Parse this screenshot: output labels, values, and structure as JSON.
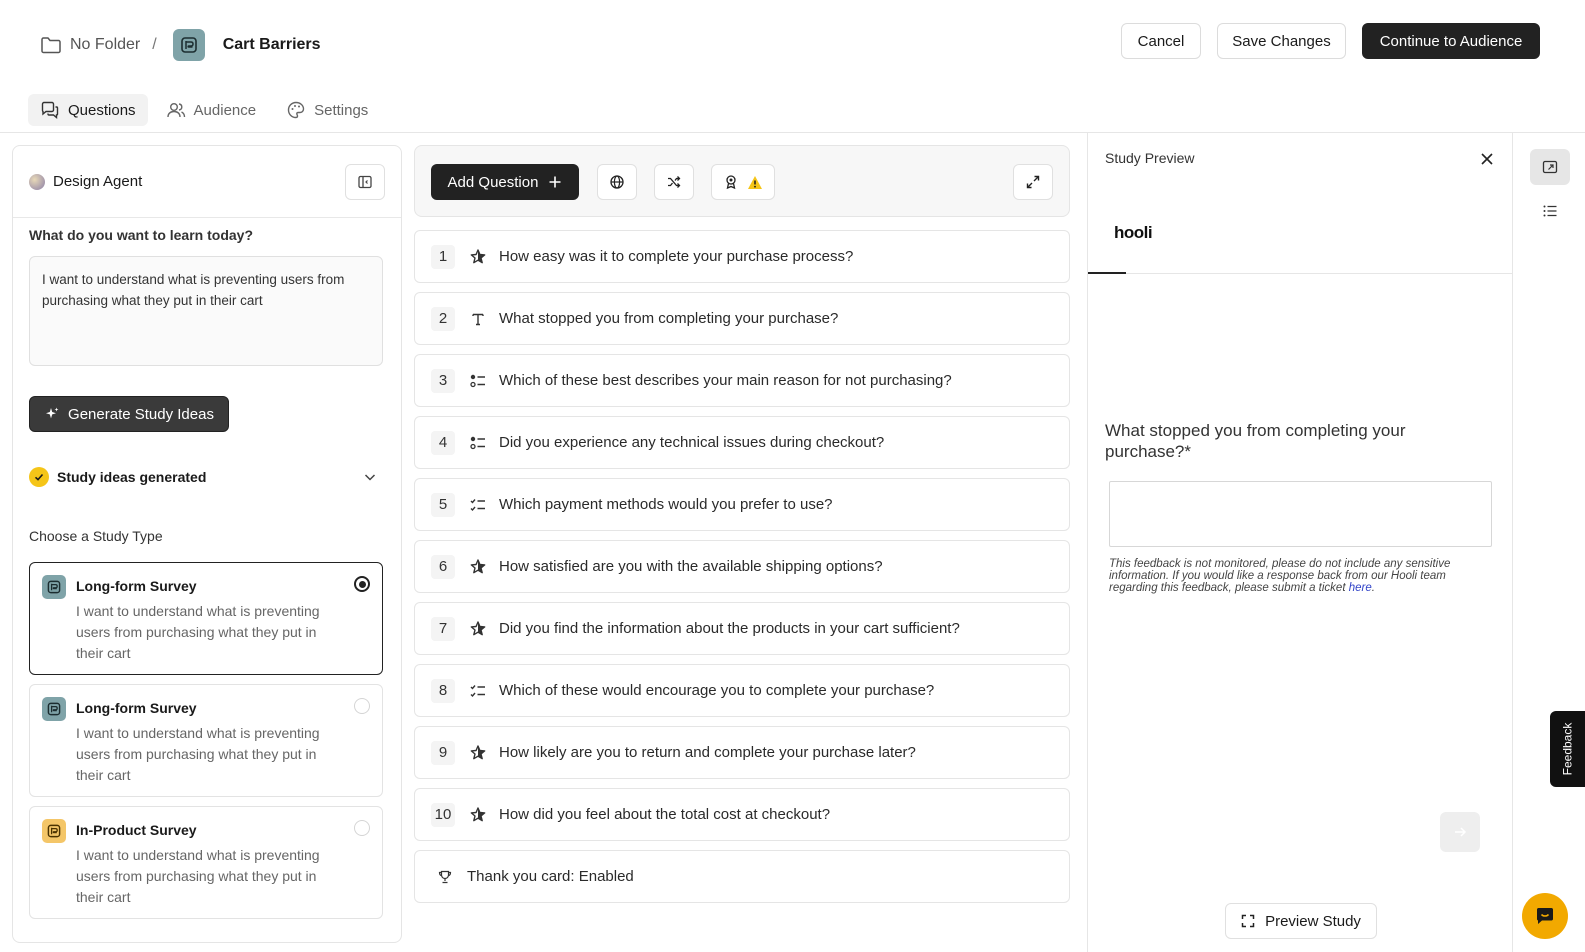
{
  "header": {
    "folder_label": "No Folder",
    "separator": "/",
    "study_title": "Cart Barriers",
    "cancel_label": "Cancel",
    "save_label": "Save Changes",
    "continue_label": "Continue to Audience"
  },
  "tabs": [
    {
      "label": "Questions",
      "icon": "chat-icon",
      "active": true
    },
    {
      "label": "Audience",
      "icon": "users-icon",
      "active": false
    },
    {
      "label": "Settings",
      "icon": "palette-icon",
      "active": false
    }
  ],
  "agent": {
    "title": "Design Agent",
    "prompt_label": "What do you want to learn today?",
    "prompt_value": "I want to understand what is preventing users from purchasing what they put in their cart",
    "generate_label": "Generate Study Ideas",
    "ideas_status": "Study ideas generated",
    "choose_label": "Choose a Study Type",
    "study_types": [
      {
        "title": "Long-form Survey",
        "desc": "I want to understand what is preventing users from purchasing what they put in their cart",
        "selected": true,
        "icon": "long-form-survey-icon"
      },
      {
        "title": "Long-form Survey",
        "desc": "I want to understand what is preventing users from purchasing what they put in their cart",
        "selected": false,
        "icon": "long-form-survey-icon"
      },
      {
        "title": "In-Product Survey",
        "desc": "I want to understand what is preventing users from purchasing what they put in their cart",
        "selected": false,
        "icon": "in-product-survey-icon"
      }
    ]
  },
  "toolbar": {
    "add_question_label": "Add Question"
  },
  "questions": [
    {
      "num": "1",
      "type": "rating",
      "text": "How easy was it to complete your purchase process?"
    },
    {
      "num": "2",
      "type": "text",
      "text": "What stopped you from completing your purchase?"
    },
    {
      "num": "3",
      "type": "single-choice",
      "text": "Which of these best describes your main reason for not purchasing?"
    },
    {
      "num": "4",
      "type": "single-choice",
      "text": "Did you experience any technical issues during checkout?"
    },
    {
      "num": "5",
      "type": "multi-choice",
      "text": "Which payment methods would you prefer to use?"
    },
    {
      "num": "6",
      "type": "rating",
      "text": "How satisfied are you with the available shipping options?"
    },
    {
      "num": "7",
      "type": "rating",
      "text": "Did you find the information about the products in your cart sufficient?"
    },
    {
      "num": "8",
      "type": "multi-choice",
      "text": "Which of these would encourage you to complete your purchase?"
    },
    {
      "num": "9",
      "type": "rating",
      "text": "How likely are you to return and complete your purchase later?"
    },
    {
      "num": "10",
      "type": "rating",
      "text": "How did you feel about the total cost at checkout?"
    }
  ],
  "thank_you": "Thank you card: Enabled",
  "preview": {
    "title": "Study Preview",
    "brand": "hooli",
    "question": "What stopped you from completing your purchase?*",
    "note_text": "This feedback is not monitored, please do not include any sensitive information. If you would like a response back from our Hooli team regarding this feedback, please submit a ticket ",
    "note_link": "here",
    "note_end": ".",
    "preview_btn": "Preview Study"
  },
  "feedback_tab": "Feedback",
  "colors": {
    "primary_dark": "#222222",
    "warning": "#f5c518",
    "accent_fab": "#f2a900",
    "link": "#3244c8"
  }
}
